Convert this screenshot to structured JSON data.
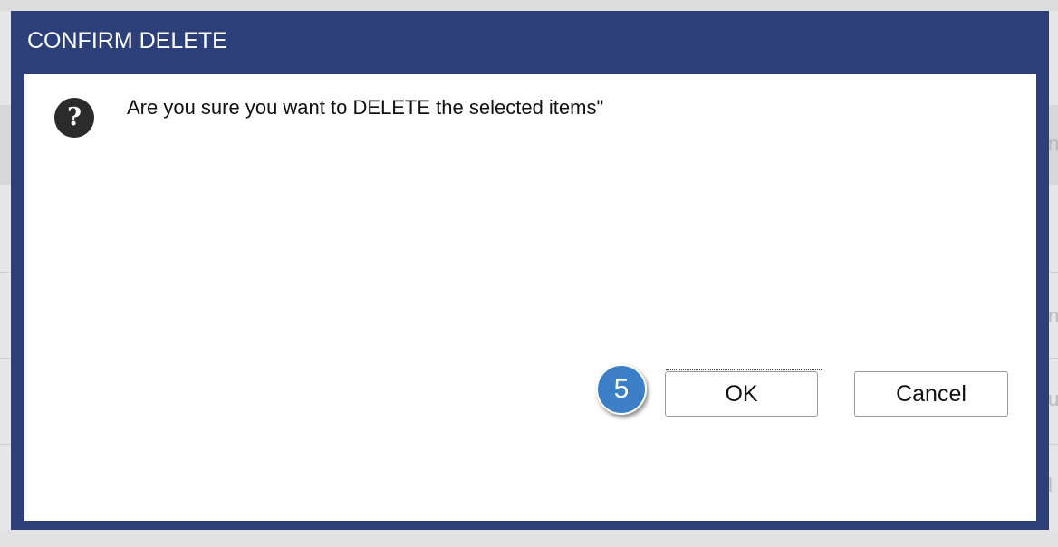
{
  "dialog": {
    "title": "CONFIRM DELETE",
    "message": "Are you sure you want to DELETE the selected items\"",
    "icon": "question-icon",
    "icon_glyph": "?",
    "ok_label": "OK",
    "cancel_label": "Cancel"
  },
  "step_badge": {
    "number": "5"
  },
  "background": {
    "edge_chars": [
      "n",
      "n",
      "u",
      "l"
    ]
  },
  "colors": {
    "dialog_header": "#2c3f78",
    "badge": "#3d7fc6"
  }
}
